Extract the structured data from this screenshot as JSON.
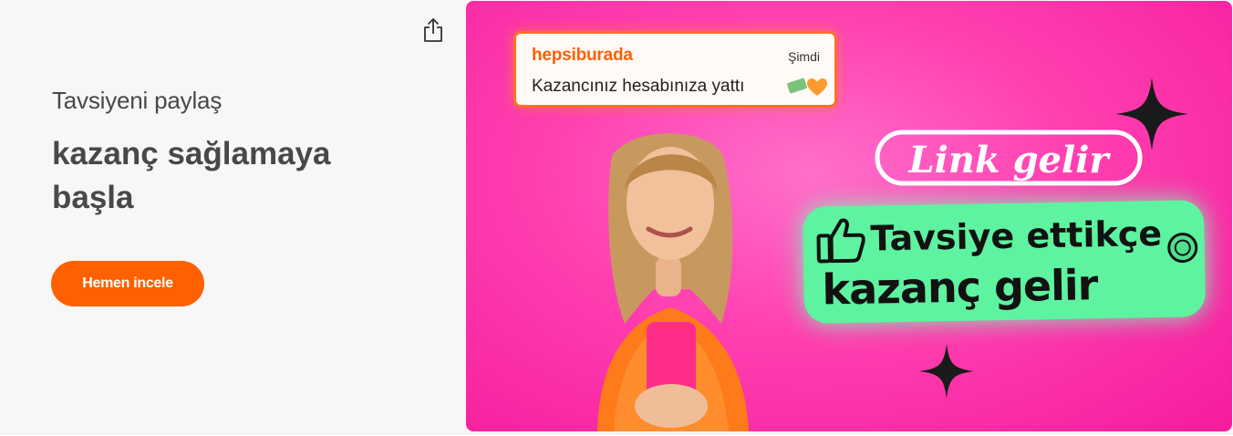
{
  "share": {
    "icon": "share-icon"
  },
  "promo": {
    "subtitle": "Tavsiyeni paylaş",
    "headline": "kazanç sağlamaya başla",
    "cta_label": "Hemen incele",
    "cta_color": "#ff6000"
  },
  "banner": {
    "notification": {
      "brand": "hepsiburada",
      "time": "Şimdi",
      "message": "Kazancınız hesabınıza yattı"
    },
    "logo_text": "Link gelir",
    "slogan_line1": "Tavsiye ettikçe",
    "slogan_line2": "kazanç gelir",
    "background_color": "#ff3fb0",
    "slogan_color": "#5ef3a0"
  }
}
